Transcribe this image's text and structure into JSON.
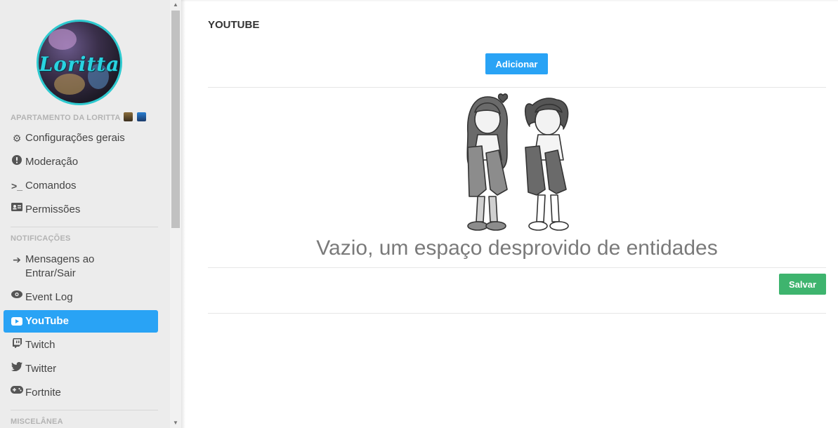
{
  "sidebar": {
    "avatar_text": "Loritta",
    "server_name": "APARTAMENTO DA LORITTA",
    "server_emojis": [
      "building-emoji",
      "city-emoji"
    ],
    "section_general": {
      "items": [
        {
          "label": "Configurações gerais",
          "icon": "gears-icon"
        },
        {
          "label": "Moderação",
          "icon": "exclamation-circle-icon"
        },
        {
          "label": "Comandos",
          "icon": "terminal-icon"
        },
        {
          "label": "Permissões",
          "icon": "id-card-icon"
        }
      ]
    },
    "section_notifications": {
      "title": "NOTIFICAÇÕES",
      "items": [
        {
          "label": "Mensagens ao Entrar/Sair",
          "icon": "sign-in-icon"
        },
        {
          "label": "Event Log",
          "icon": "eye-icon"
        },
        {
          "label": "YouTube",
          "icon": "youtube-icon",
          "active": true
        },
        {
          "label": "Twitch",
          "icon": "twitch-icon"
        },
        {
          "label": "Twitter",
          "icon": "twitter-icon"
        },
        {
          "label": "Fortnite",
          "icon": "gamepad-icon"
        }
      ]
    },
    "section_misc": {
      "title": "MISCELÂNEA"
    }
  },
  "main": {
    "title": "YOUTUBE",
    "add_button": "Adicionar",
    "empty_state_text": "Vazio, um espaço desprovido de entidades",
    "save_button": "Salvar"
  },
  "colors": {
    "accent_blue": "#29a3f5",
    "save_green": "#3eb46e",
    "sidebar_bg": "#ececec",
    "avatar_ring": "#2ec9cf"
  }
}
